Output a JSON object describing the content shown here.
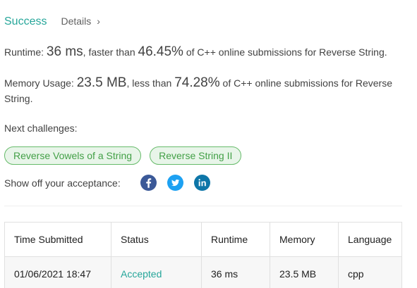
{
  "header": {
    "status": "Success",
    "details_label": "Details",
    "details_chevron": "›"
  },
  "runtime": {
    "label": "Runtime:",
    "value": "36 ms",
    "mid": ", faster than",
    "percent": "46.45%",
    "suffix": "of C++ online submissions for Reverse String."
  },
  "memory": {
    "label": "Memory Usage:",
    "value": "23.5 MB",
    "mid": ", less than",
    "percent": "74.28%",
    "suffix": "of C++ online submissions for Reverse String."
  },
  "next": {
    "label": "Next challenges:",
    "challenges": [
      "Reverse Vowels of a String",
      "Reverse String II"
    ]
  },
  "share": {
    "label": "Show off your acceptance:",
    "icons": [
      "facebook-icon",
      "twitter-icon",
      "linkedin-icon"
    ]
  },
  "table": {
    "headers": [
      "Time Submitted",
      "Status",
      "Runtime",
      "Memory",
      "Language"
    ],
    "rows": [
      [
        "01/06/2021 18:47",
        "Accepted",
        "36 ms",
        "23.5 MB",
        "cpp"
      ]
    ]
  },
  "colors": {
    "accent": "#26a69a",
    "chip_border": "#66bb6a",
    "chip_bg": "#e8f5e9",
    "chip_text": "#43a047",
    "facebook": "#3b5998",
    "twitter": "#1da1f2",
    "linkedin": "#0e76a8"
  }
}
